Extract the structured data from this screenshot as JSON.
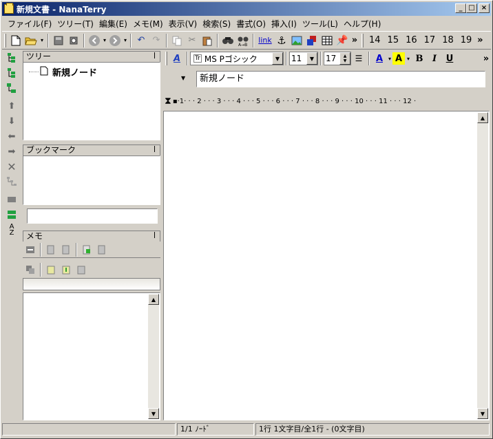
{
  "window": {
    "title": "新規文書 - NanaTerry",
    "min": "_",
    "max": "□",
    "close": "×"
  },
  "menu": [
    "ファイル(F)",
    "ツリー(T)",
    "編集(E)",
    "メモ(M)",
    "表示(V)",
    "検索(S)",
    "書式(O)",
    "挿入(I)",
    "ツール(L)",
    "ヘルプ(H)"
  ],
  "toolbar": {
    "overflow": "»",
    "numbers": [
      "14",
      "15",
      "16",
      "17",
      "18",
      "19"
    ],
    "link_label": "link"
  },
  "tree_panel": {
    "title": "ツリー",
    "pin": "ꟾ",
    "node": "新規ノード"
  },
  "bookmark_panel": {
    "title": "ブックマーク",
    "pin": "ꟾ"
  },
  "memo_panel": {
    "title": "メモ",
    "pin": "ꟾ"
  },
  "format_toolbar": {
    "font": "MS Pゴシック",
    "size": "11",
    "line_spacing": "17",
    "bold": "B",
    "italic": "I",
    "underline": "U",
    "font_color": "A",
    "highlight": "A",
    "overflow": "»"
  },
  "node_title": "新規ノード",
  "ruler": "▪·1·  ·  · 2 ·  ·  · 3 ·  ·  · 4 ·  ·  · 5 ·  ·  · 6 ·  ·  · 7 ·  ·  · 8 ·  ·  · 9 ·  ·  · 10 ·  ·  · 11 ·  ·  · 12 ·",
  "status": {
    "left": "",
    "nodes": "1/1 ﾉｰﾄﾞ",
    "position": "1行 1文字目/全1行 - (0文字目)"
  },
  "colors": {
    "title_start": "#0a246a",
    "title_end": "#a6caf0",
    "face": "#d4d0c8",
    "highlight": "#ffff00",
    "font_color": "#0000cc"
  }
}
